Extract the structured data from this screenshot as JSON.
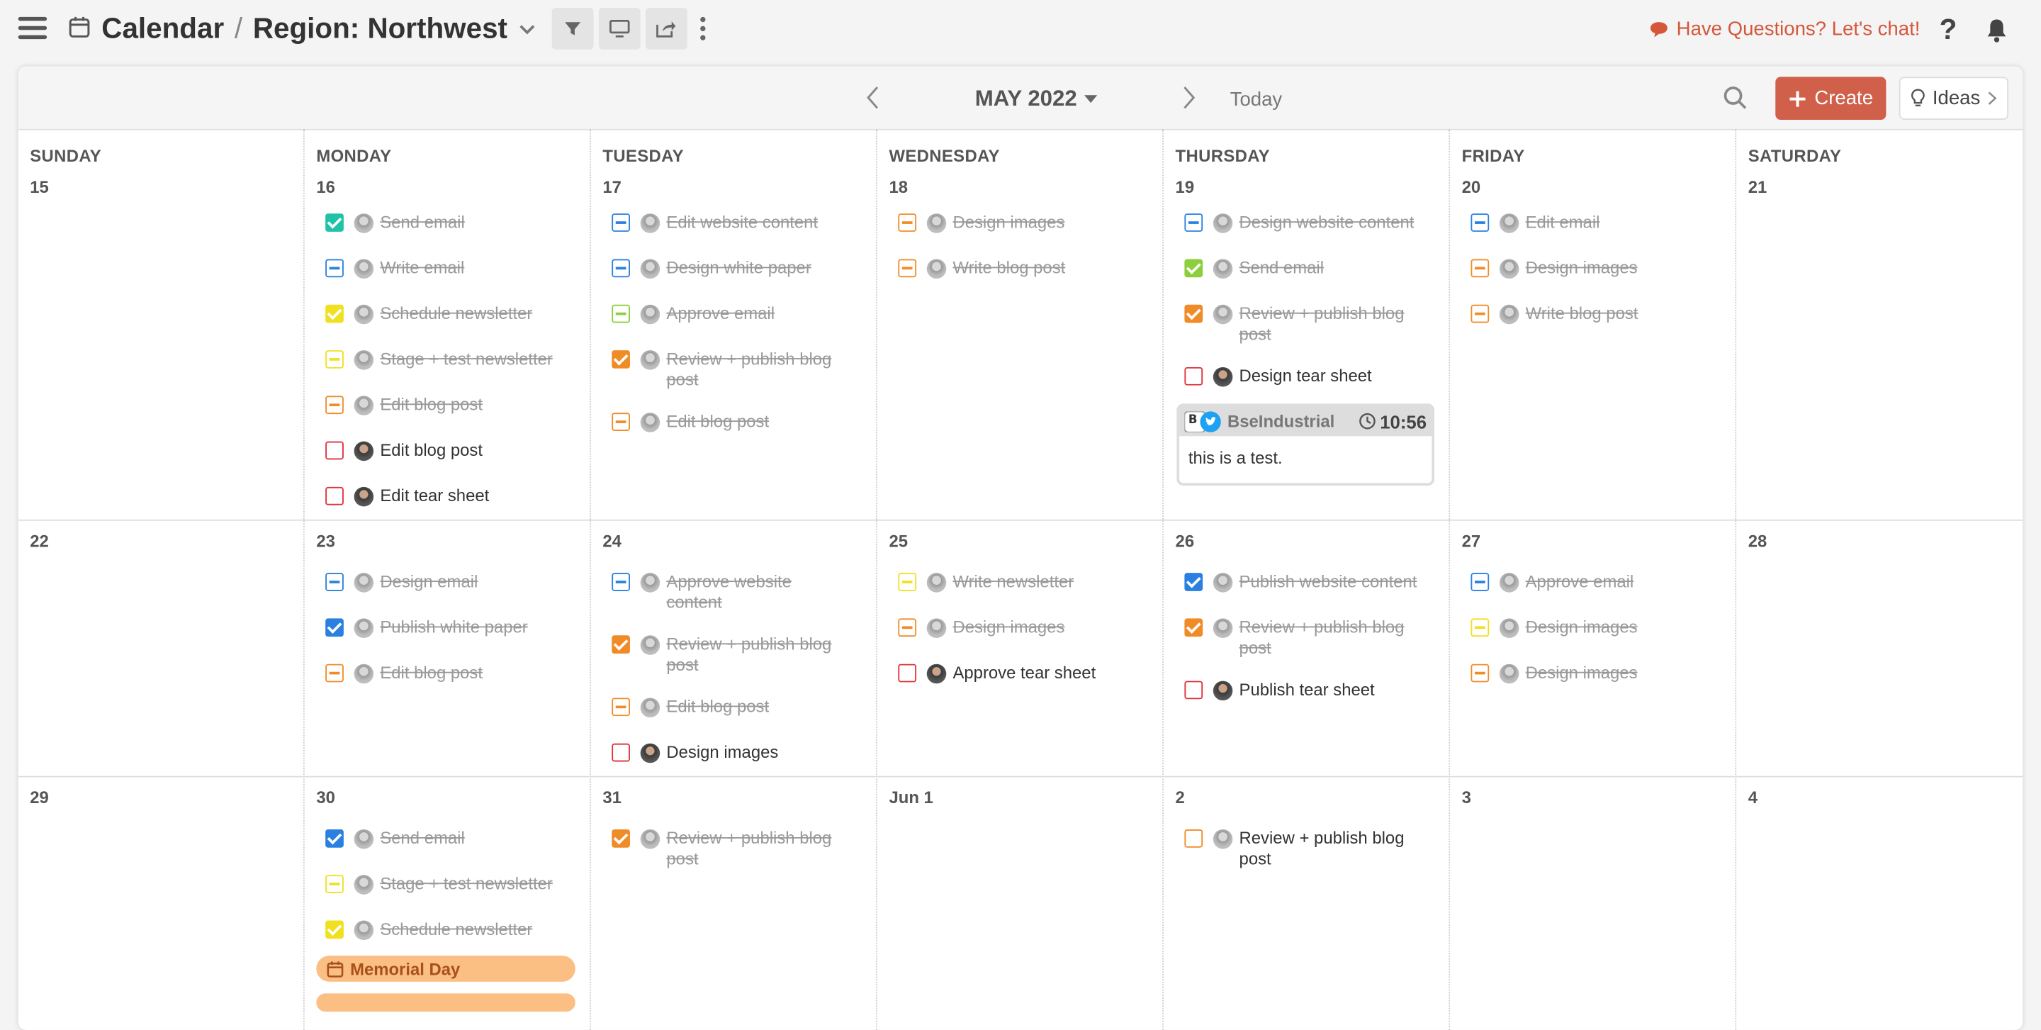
{
  "header": {
    "app_name": "Calendar",
    "separator": "/",
    "view_name": "Region: Northwest",
    "chat_label": "Have Questions? Let's chat!",
    "help_label": "?"
  },
  "toolbar": {
    "month_label": "MAY 2022",
    "today_label": "Today",
    "create_label": "Create",
    "ideas_label": "Ideas"
  },
  "weekdays": [
    "SUNDAY",
    "MONDAY",
    "TUESDAY",
    "WEDNESDAY",
    "THURSDAY",
    "FRIDAY",
    "SATURDAY"
  ],
  "weeks": [
    {
      "dates": [
        "15",
        "16",
        "17",
        "18",
        "19",
        "20",
        "21"
      ]
    },
    {
      "dates": [
        "22",
        "23",
        "24",
        "25",
        "26",
        "27",
        "28"
      ]
    },
    {
      "dates": [
        "29",
        "30",
        "31",
        "Jun 1",
        "2",
        "3",
        "4"
      ]
    }
  ],
  "colors": {
    "blue": "#2a80e0",
    "teal": "#1fc2a6",
    "yellow": "#f0e020",
    "orange": "#f08c28",
    "red": "#e0303a",
    "green": "#8ccf3c",
    "accent": "#d0604a"
  },
  "tasks": {
    "w1": {
      "mon": [
        "Send email",
        "Write email",
        "Schedule newsletter",
        "Stage + test newsletter",
        "Edit blog post",
        "Edit blog post",
        "Edit tear sheet"
      ],
      "tue": [
        "Edit website content",
        "Design white paper",
        "Approve email",
        "Review + publish blog post",
        "Edit blog post"
      ],
      "wed": [
        "Design images",
        "Write blog post"
      ],
      "thu": [
        "Design website content",
        "Send email",
        "Review + publish blog post",
        "Design tear sheet"
      ],
      "fri": [
        "Edit email",
        "Design images",
        "Write blog post"
      ]
    },
    "w2": {
      "mon": [
        "Design email",
        "Publish white paper",
        "Edit blog post"
      ],
      "tue": [
        "Approve website content",
        "Review + publish blog post",
        "Edit blog post",
        "Design images"
      ],
      "wed": [
        "Write newsletter",
        "Design images",
        "Approve tear sheet"
      ],
      "thu": [
        "Publish website content",
        "Review + publish blog post",
        "Publish tear sheet"
      ],
      "fri": [
        "Approve email",
        "Design images",
        "Design images"
      ]
    },
    "w3": {
      "mon": [
        "Send email",
        "Stage + test newsletter",
        "Schedule newsletter"
      ],
      "tue": [
        "Review + publish blog post"
      ],
      "thu": [
        "Review + publish blog post"
      ]
    }
  },
  "social_post": {
    "account": "BseIndustrial",
    "time": "10:56",
    "text": "this is a test."
  },
  "holidays": [
    "Memorial Day"
  ]
}
